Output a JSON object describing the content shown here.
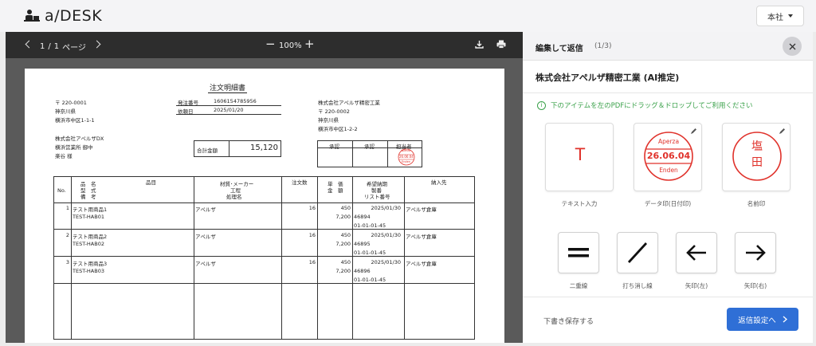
{
  "app": {
    "logo_text": "a/DESK",
    "branch_label": "本社"
  },
  "viewer": {
    "page_current": "1",
    "page_sep": "/",
    "page_total": "1",
    "page_unit": "ページ",
    "zoom": "100%"
  },
  "document": {
    "title": "注文明細書",
    "from": {
      "postal": "〒 220-0001",
      "pref": "神奈川県",
      "addr": "横浜市中区1-1-1"
    },
    "order_fields": [
      {
        "label": "発注番号",
        "value": "1606154785956"
      },
      {
        "label": "依頼日",
        "value": "2025/01/20"
      }
    ],
    "to": {
      "name": "株式会社アペルザ精密工業",
      "postal": "〒 220-0002",
      "pref": "神奈川県",
      "addr": "横浜市中区1-2-2"
    },
    "buyer": {
      "company": "株式会社アペルザDX",
      "office": "横浜営業所 御中",
      "person": "楽谷 様"
    },
    "total": {
      "label": "合計金額",
      "value": "15,120"
    },
    "approvals": [
      "承認",
      "承認",
      "担当者"
    ],
    "mini_stamp": {
      "top": "Aperza",
      "date": "26.06.04",
      "bottom": "Enden"
    },
    "columns": {
      "no": "No.",
      "names": [
        "品　名",
        "型　式",
        "備　考"
      ],
      "item": "品目",
      "maker": [
        "材質･メーカー",
        "工程",
        "処理名"
      ],
      "qty": "注文数",
      "price": [
        "単　価",
        "金　額"
      ],
      "due": [
        "希望納期",
        "製番",
        "リスト番号"
      ],
      "dest": "納入先"
    },
    "rows": [
      {
        "no": "1",
        "name": "テスト用商品1",
        "model": "TEST-HAB01",
        "maker": "アペルザ",
        "qty": "16",
        "unit": "450",
        "amount": "7,200",
        "due": "2025/01/30",
        "lot": "46894",
        "list": "01-01-01-45",
        "dest": "アペルザ倉庫"
      },
      {
        "no": "2",
        "name": "テスト用商品2",
        "model": "TEST-HAB02",
        "maker": "アペルザ",
        "qty": "16",
        "unit": "450",
        "amount": "7,200",
        "due": "2025/01/30",
        "lot": "46895",
        "list": "01-01-01-45",
        "dest": "アペルザ倉庫"
      },
      {
        "no": "3",
        "name": "テスト用商品3",
        "model": "TEST-HAB03",
        "maker": "アペルザ",
        "qty": "16",
        "unit": "450",
        "amount": "7,200",
        "due": "2025/01/30",
        "lot": "46896",
        "list": "01-01-01-45",
        "dest": "アペルザ倉庫"
      }
    ]
  },
  "panel": {
    "title": "編集して返信",
    "step": "(1/3)",
    "company": "株式会社アペルザ精密工業 (AI推定)",
    "hint": "下のアイテムを左のPDFにドラッグ＆ドロップしてご利用ください",
    "text_tool": {
      "glyph": "T",
      "label": "テキスト入力"
    },
    "date_stamp": {
      "top": "Aperza",
      "date": "26.06.04",
      "bottom": "Enden",
      "label": "データ印(日付印)"
    },
    "name_stamp": {
      "chars": [
        "塩",
        "田"
      ],
      "label": "名前印"
    },
    "tools": [
      {
        "icon": "double-line-icon",
        "label": "二重線"
      },
      {
        "icon": "strike-line-icon",
        "label": "打ち消し線"
      },
      {
        "icon": "arrow-left-icon",
        "label": "矢印(左)"
      },
      {
        "icon": "arrow-right-icon",
        "label": "矢印(右)"
      }
    ],
    "save_draft": "下書き保存する",
    "next_button": "返信設定へ",
    "colors": {
      "accent": "#2f6fd6",
      "stamp_red": "#e0322b",
      "hint_green": "#3aa14a"
    }
  }
}
